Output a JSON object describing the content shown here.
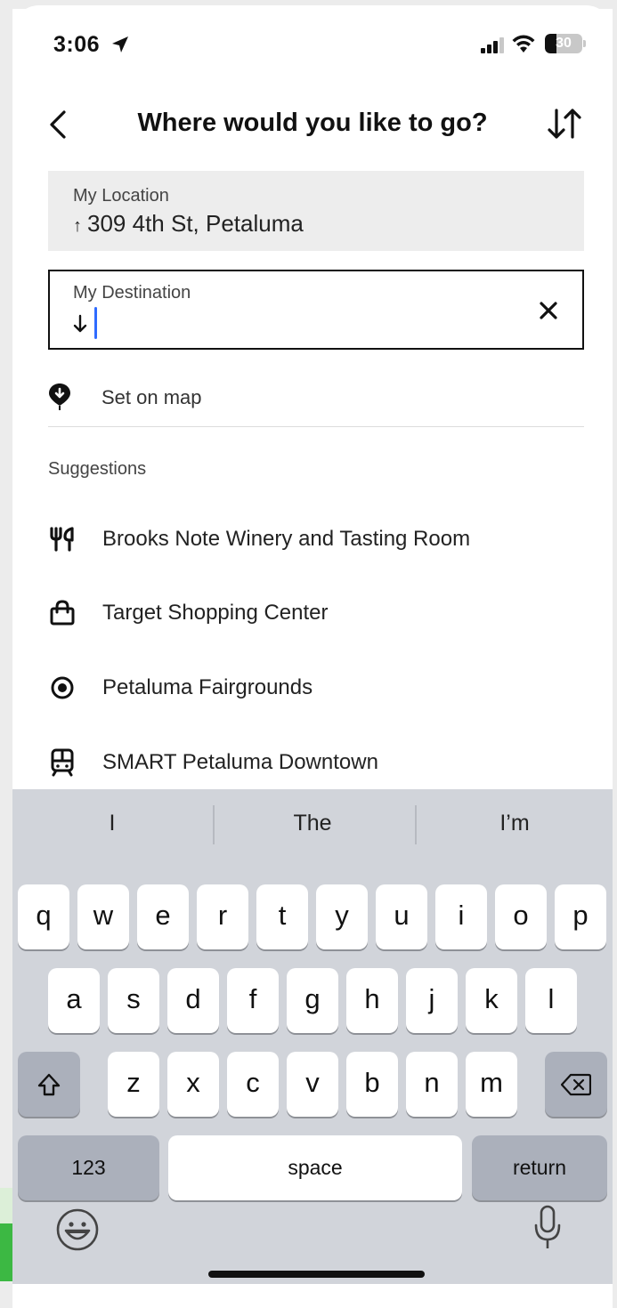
{
  "status_bar": {
    "time": "3:06",
    "battery": "30",
    "battery_level": 0.3
  },
  "header": {
    "title": "Where would you like to go?"
  },
  "origin": {
    "label": "My Location",
    "value": "309 4th St, Petaluma"
  },
  "destination": {
    "label": "My Destination",
    "value": ""
  },
  "set_on_map": "Set on map",
  "suggestions": {
    "title": "Suggestions",
    "items": [
      {
        "label": "Brooks Note Winery and Tasting Room",
        "icon": "restaurant-icon"
      },
      {
        "label": "Target Shopping Center",
        "icon": "shopping-bag-icon"
      },
      {
        "label": "Petaluma Fairgrounds",
        "icon": "place-icon"
      },
      {
        "label": "SMART Petaluma Downtown",
        "icon": "train-icon"
      }
    ]
  },
  "keyboard": {
    "predictions": [
      "I",
      "The",
      "I’m"
    ],
    "row1": [
      "q",
      "w",
      "e",
      "r",
      "t",
      "y",
      "u",
      "i",
      "o",
      "p"
    ],
    "row2": [
      "a",
      "s",
      "d",
      "f",
      "g",
      "h",
      "j",
      "k",
      "l"
    ],
    "row3": [
      "z",
      "x",
      "c",
      "v",
      "b",
      "n",
      "m"
    ],
    "numbers_label": "123",
    "space_label": "space",
    "return_label": "return"
  },
  "colors": {
    "caret": "#2f6bff",
    "keyboard_bg": "#d1d4da",
    "key_dark": "#abb0bb"
  }
}
